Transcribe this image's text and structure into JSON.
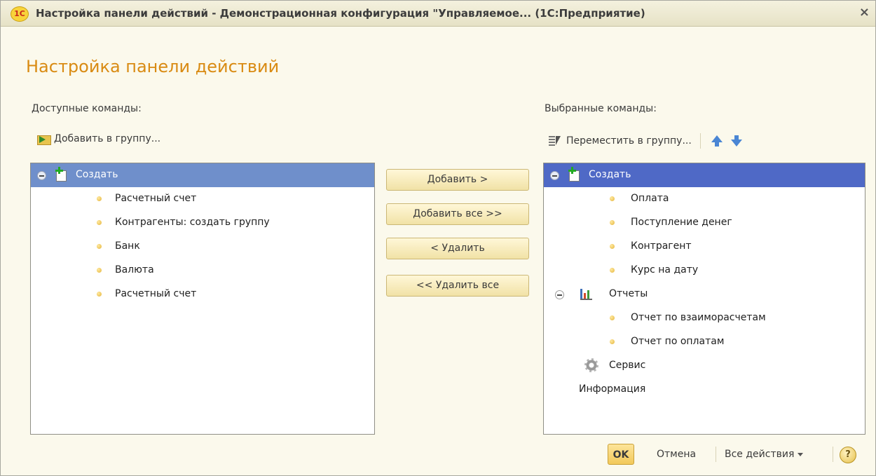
{
  "window": {
    "logo_text": "1С",
    "title": "Настройка панели действий - Демонстрационная конфигурация \"Управляемое...  (1С:Предприятие)",
    "close_label": "×"
  },
  "heading": "Настройка панели действий",
  "left": {
    "label": "Доступные команды:",
    "toolbar_add": "Добавить в группу...",
    "items": [
      {
        "label": "Создать",
        "kind": "group",
        "icon": "create-document-icon",
        "selected": true
      },
      {
        "label": "Расчетный счет",
        "kind": "item"
      },
      {
        "label": "Контрагенты: создать группу",
        "kind": "item"
      },
      {
        "label": "Банк",
        "kind": "item"
      },
      {
        "label": "Валюта",
        "kind": "item"
      },
      {
        "label": "Расчетный счет",
        "kind": "item"
      }
    ]
  },
  "right": {
    "label": "Выбранные команды:",
    "toolbar_move": "Переместить в группу...",
    "items": [
      {
        "label": "Создать",
        "kind": "group",
        "icon": "create-document-icon",
        "selected": true
      },
      {
        "label": "Оплата",
        "kind": "item"
      },
      {
        "label": "Поступление денег",
        "kind": "item"
      },
      {
        "label": "Контрагент",
        "kind": "item"
      },
      {
        "label": "Курс на дату",
        "kind": "item"
      },
      {
        "label": "Отчеты",
        "kind": "group",
        "icon": "report-chart-icon"
      },
      {
        "label": "Отчет по взаиморасчетам",
        "kind": "item"
      },
      {
        "label": "Отчет по оплатам",
        "kind": "item"
      },
      {
        "label": "Сервис",
        "kind": "group",
        "icon": "gear-icon"
      },
      {
        "label": "Информация",
        "kind": "group"
      }
    ]
  },
  "buttons": {
    "add": "Добавить >",
    "add_all": "Добавить все >>",
    "remove": "< Удалить",
    "remove_all": "<< Удалить все"
  },
  "footer": {
    "ok": "OK",
    "cancel": "Отмена",
    "all_actions": "Все действия",
    "help": "?"
  },
  "colors": {
    "heading": "#d98b13",
    "background": "#fbf9ec",
    "selection_left": "#6f8fcb",
    "selection_right": "#4f69c6"
  }
}
